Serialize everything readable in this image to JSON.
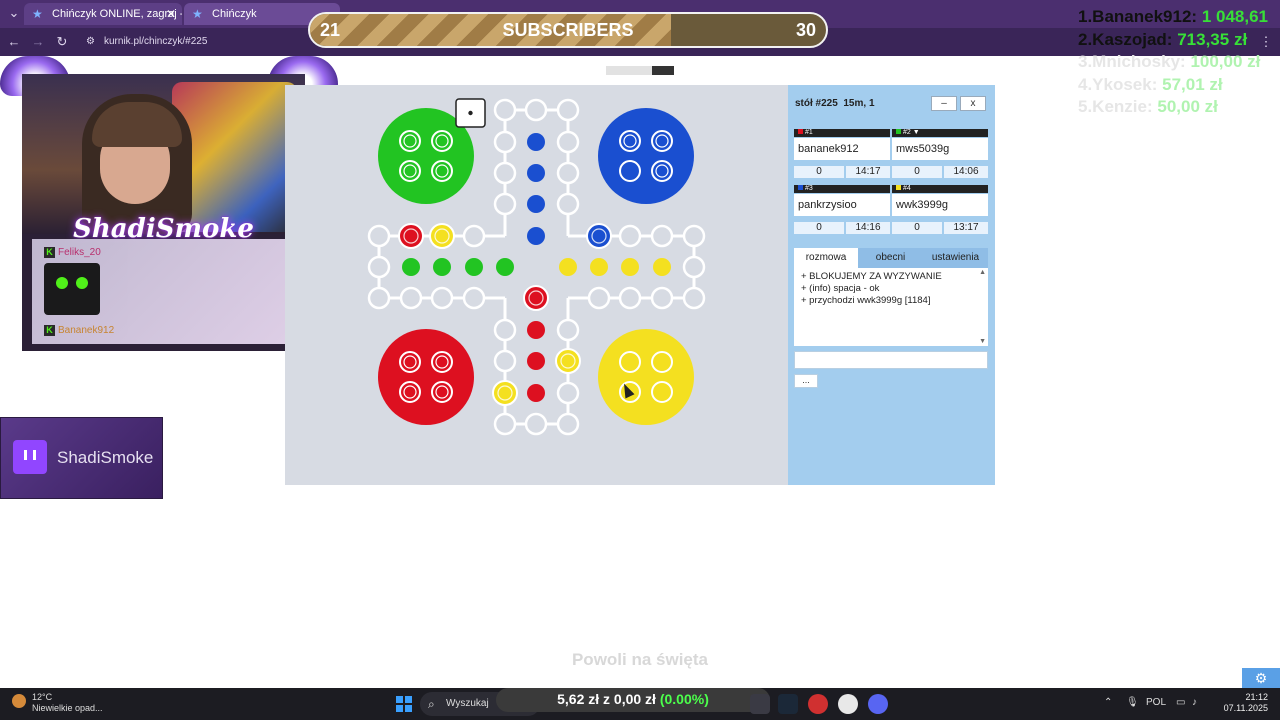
{
  "browser": {
    "tabs": [
      {
        "title": "Chińczyk ONLINE, zagraj - Kurn",
        "active": false
      },
      {
        "title": "Chińczyk",
        "active": true
      }
    ],
    "url": "kurnik.pl/chinczyk/#225"
  },
  "subscriber_goal": {
    "current": "21",
    "label": "SUBSCRIBERS",
    "target": "30",
    "progress_fraction": 0.7
  },
  "leaderboard": [
    {
      "name": "1.Bananek912:",
      "amount": "1 048,61",
      "faded": false
    },
    {
      "name": "2.Kaszojad:",
      "amount": "713,35 zł",
      "faded": false
    },
    {
      "name": "3.Mnichosky:",
      "amount": "100,00 zł",
      "faded": true
    },
    {
      "name": "4.Ykosek:",
      "amount": "57,01 zł",
      "faded": true
    },
    {
      "name": "5.Kenzie:",
      "amount": "50,00 zł",
      "faded": true
    }
  ],
  "stream": {
    "streamer_name": "ShadiSmoke",
    "chat": [
      {
        "user": "Feliks_20"
      },
      {
        "user": "Bananek912"
      }
    ],
    "twitch_label": "ShadiSmoke"
  },
  "game": {
    "colors": {
      "green": "#22c422",
      "blue": "#1a4fd0",
      "red": "#dd1020",
      "yellow": "#f4e020",
      "board_bg": "#d7dbe3",
      "panel_bg": "#a3cdee"
    },
    "table_title": "stół #225",
    "table_info": "15m, 1",
    "minimize_label": "–",
    "close_label": "x",
    "players": [
      {
        "slot": "#1",
        "name": "bananek912",
        "score": "0",
        "time": "14:17",
        "color": "#dd1020"
      },
      {
        "slot": "#2 ▼",
        "name": "mws5039g",
        "score": "0",
        "time": "14:06",
        "color": "#22c422"
      },
      {
        "slot": "#3",
        "name": "pankrzysioo",
        "score": "0",
        "time": "14:16",
        "color": "#1a4fd0"
      },
      {
        "slot": "#4",
        "name": "wwk3999g",
        "score": "0",
        "time": "13:17",
        "color": "#f4e020"
      }
    ],
    "tabs": [
      "rozmowa",
      "obecni",
      "ustawienia"
    ],
    "chat_lines": [
      "+ BLOKUJEMY ZA WYZYWANIE",
      "+ (info) spacja - ok",
      "+ przychodzi wwk3999g [1184]"
    ],
    "more_button": "...",
    "dice_value": 1
  },
  "overlay_subtitle": "Powoli na święta",
  "taskbar": {
    "weather_temp": "12°C",
    "weather_desc": "Niewielkie opad...",
    "search_label": "Wyszukaj",
    "money_a": "5,62 zł",
    "money_sep": "z",
    "money_b": "0,00 zł",
    "money_pct": "(0.00%)",
    "language": "POL",
    "time": "21:12",
    "date": "07.11.2025"
  }
}
